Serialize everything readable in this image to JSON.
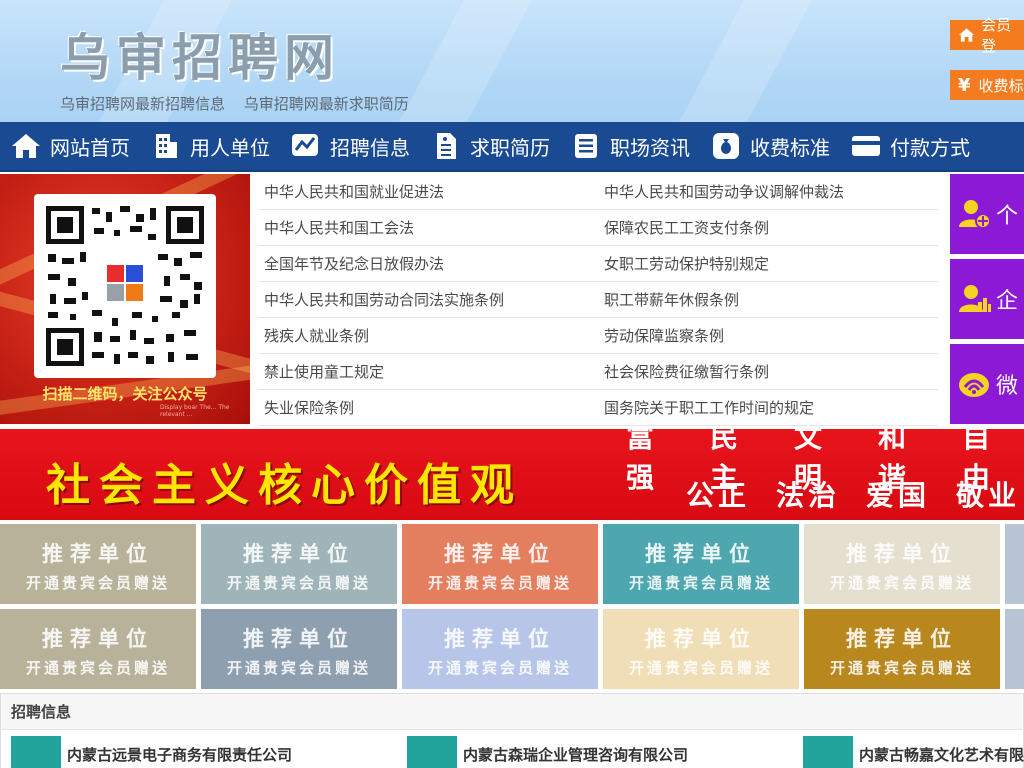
{
  "header": {
    "site_title": "乌审招聘网",
    "sub_links": [
      "乌审招聘网最新招聘信息",
      "乌审招聘网最新求职简历"
    ],
    "member_login": "会员登",
    "pricing": "收费标"
  },
  "nav": [
    {
      "label": "网站首页",
      "icon": "home-icon"
    },
    {
      "label": "用人单位",
      "icon": "building-icon"
    },
    {
      "label": "招聘信息",
      "icon": "chart-icon"
    },
    {
      "label": "求职简历",
      "icon": "resume-icon"
    },
    {
      "label": "职场资讯",
      "icon": "news-icon"
    },
    {
      "label": "收费标准",
      "icon": "money-bag-icon"
    },
    {
      "label": "付款方式",
      "icon": "card-icon"
    }
  ],
  "qr": {
    "caption": "扫描二维码，关注公众号",
    "small_text": "Display boar The... The relevant ..."
  },
  "laws": [
    [
      "中华人民共和国就业促进法",
      "中华人民共和国劳动争议调解仲裁法"
    ],
    [
      "中华人民共和国工会法",
      "保障农民工工资支付条例"
    ],
    [
      "全国年节及纪念日放假办法",
      "女职工劳动保护特别规定"
    ],
    [
      "中华人民共和国劳动合同法实施条例",
      "职工带薪年休假条例"
    ],
    [
      "残疾人就业条例",
      "劳动保障监察条例"
    ],
    [
      "禁止使用童工规定",
      "社会保险费征缴暂行条例"
    ],
    [
      "失业保险条例",
      "国务院关于职工工作时间的规定"
    ]
  ],
  "side_buttons": [
    {
      "label": "个",
      "icon": "person-add-icon"
    },
    {
      "label": "企",
      "icon": "enterprise-user-icon"
    },
    {
      "label": "微",
      "icon": "wechat-icon"
    }
  ],
  "banner": {
    "main": "社会主义核心价值观",
    "line1": [
      "富强",
      "民主",
      "文明",
      "和谐",
      "自由"
    ],
    "line2": [
      "公正",
      "法治",
      "爱国",
      "敬业"
    ]
  },
  "tiles": {
    "title": "推荐单位",
    "subtitle": "开通贵宾会员赠送",
    "row1_colors": [
      "#b8b29a",
      "#9fb4b8",
      "#e37e5f",
      "#4ea6ae",
      "#e5dfcf",
      "#b7c4d4"
    ],
    "row2_colors": [
      "#b8b29a",
      "#8e9fb0",
      "#b7c6e8",
      "#f0dfb6",
      "#b8871e",
      "#b7c4d4"
    ]
  },
  "recruit": {
    "heading": "招聘信息",
    "companies": [
      "内蒙古远景电子商务有限责任公司",
      "内蒙古森瑞企业管理咨询有限公司",
      "内蒙古畅嘉文化艺术有限"
    ]
  },
  "colors": {
    "nav_bg": "#1a4a92",
    "accent_orange": "#f57c1e",
    "purple": "#8b19d6",
    "banner_red": "#e8141c",
    "banner_yellow": "#ffe600"
  }
}
